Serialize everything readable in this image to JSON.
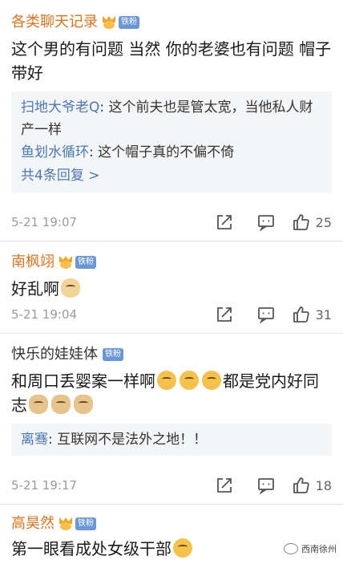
{
  "comments": [
    {
      "author": "各类聊天记录",
      "badge": "铁粉",
      "text": "这个男的有问题 当然 你的老婆也有问题 帽子带好",
      "replies": [
        {
          "author": "扫地大爷老Q",
          "sep": ": ",
          "text": "这个前夫也是管太宽，当他私人财产一样"
        },
        {
          "author": "鱼划水循环",
          "sep": ": ",
          "text": "这个帽子真的不偏不倚"
        }
      ],
      "more": "共4条回复 >",
      "time": "5-21 19:07",
      "likes": "25"
    },
    {
      "author": "南枫翊",
      "badge": "铁粉",
      "text": "好乱啊",
      "time": "5-21 19:04",
      "likes": "31"
    },
    {
      "author": "快乐的娃娃体",
      "badge": "铁粉",
      "text_a": "和周口丢婴案一样啊",
      "text_b": "都是党内好同志",
      "replies": [
        {
          "author": "离骞",
          "sep": ": ",
          "text": "互联网不是法外之地！！"
        }
      ],
      "time": "5-21 19:17",
      "likes": "18"
    },
    {
      "author": "高昊然",
      "badge": "铁粉",
      "text": "第一眼看成处女级干部"
    }
  ],
  "watermark": "西南徐州",
  "icons": {
    "share": "share-icon",
    "comment": "comment-icon",
    "like": "thumbs-up-icon",
    "crown": "crown-icon"
  },
  "colors": {
    "author_orange": "#e0731d",
    "reply_author": "#4a78b8",
    "badge_bg": "#6b97d8"
  }
}
